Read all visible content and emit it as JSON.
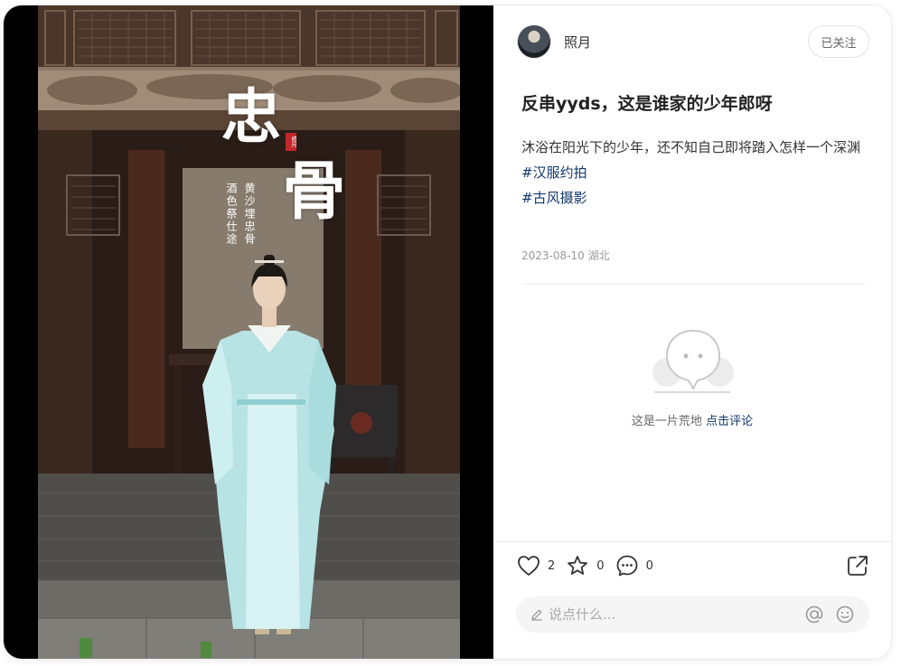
{
  "poster": {
    "title_char_1": "忠",
    "title_char_2": "骨",
    "seal_text": "照月",
    "verse_1": "黄沙埋忠骨",
    "verse_2": "酒色祭仕途"
  },
  "author": {
    "name": "照月",
    "follow_label": "已关注"
  },
  "note": {
    "title": "反串yyds，这是谁家的少年郎呀",
    "description": "沐浴在阳光下的少年，还不知自己即将踏入怎样一个深渊",
    "tags": [
      "#汉服约拍",
      "#古风摄影"
    ],
    "date": "2023-08-10",
    "location": "湖北"
  },
  "comments": {
    "empty_text": "这是一片荒地",
    "empty_link": "点击评论"
  },
  "engagement": {
    "likes": "2",
    "collects": "0",
    "comments": "0"
  },
  "comment_box": {
    "placeholder": "说点什么..."
  },
  "colors": {
    "link": "#13386c",
    "text": "#333333",
    "muted": "#999999"
  },
  "icons": [
    "heart-icon",
    "star-icon",
    "comment-icon",
    "share-icon",
    "pencil-icon",
    "at-icon",
    "emoji-icon"
  ]
}
